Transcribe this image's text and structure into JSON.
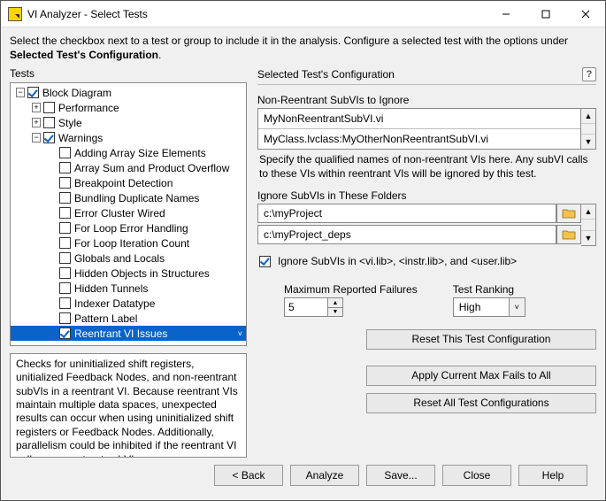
{
  "window": {
    "title": "VI Analyzer - Select Tests"
  },
  "intro": {
    "line1": "Select the checkbox next to a test or group to include it in the analysis.  Configure a selected test with the options under",
    "line2_bold": "Selected Test's Configuration",
    "period": "."
  },
  "left": {
    "label": "Tests",
    "tree": [
      {
        "depth": 0,
        "expander": "minus",
        "checked": true,
        "label": "Block Diagram"
      },
      {
        "depth": 1,
        "expander": "plus",
        "checked": false,
        "label": "Performance"
      },
      {
        "depth": 1,
        "expander": "plus",
        "checked": false,
        "label": "Style"
      },
      {
        "depth": 1,
        "expander": "minus",
        "checked": true,
        "label": "Warnings"
      },
      {
        "depth": 2,
        "expander": "",
        "checked": false,
        "label": "Adding Array Size Elements"
      },
      {
        "depth": 2,
        "expander": "",
        "checked": false,
        "label": "Array Sum and Product Overflow"
      },
      {
        "depth": 2,
        "expander": "",
        "checked": false,
        "label": "Breakpoint Detection"
      },
      {
        "depth": 2,
        "expander": "",
        "checked": false,
        "label": "Bundling Duplicate Names"
      },
      {
        "depth": 2,
        "expander": "",
        "checked": false,
        "label": "Error Cluster Wired"
      },
      {
        "depth": 2,
        "expander": "",
        "checked": false,
        "label": "For Loop Error Handling"
      },
      {
        "depth": 2,
        "expander": "",
        "checked": false,
        "label": "For Loop Iteration Count"
      },
      {
        "depth": 2,
        "expander": "",
        "checked": false,
        "label": "Globals and Locals"
      },
      {
        "depth": 2,
        "expander": "",
        "checked": false,
        "label": "Hidden Objects in Structures"
      },
      {
        "depth": 2,
        "expander": "",
        "checked": false,
        "label": "Hidden Tunnels"
      },
      {
        "depth": 2,
        "expander": "",
        "checked": false,
        "label": "Indexer Datatype"
      },
      {
        "depth": 2,
        "expander": "",
        "checked": false,
        "label": "Pattern Label"
      },
      {
        "depth": 2,
        "expander": "",
        "checked": true,
        "label": "Reentrant VI Issues",
        "selected": true
      }
    ],
    "description": "Checks for uninitialized shift registers, unitialized Feedback Nodes, and non-reentrant subVIs in a reentrant VI. Because reentrant VIs maintain multiple data spaces, unexpected results can occur when using uninitialized shift registers or Feedback Nodes. Additionally, parallelism could be inhibited if the reentrant VI calls non-reentrant subVIs."
  },
  "right": {
    "heading": "Selected Test's Configuration",
    "help_glyph": "?",
    "ignore_vis": {
      "label": "Non-Reentrant SubVIs to Ignore",
      "rows": [
        "MyNonReentrantSubVI.vi",
        "MyClass.lvclass:MyOtherNonReentrantSubVI.vi"
      ],
      "hint": "Specify the qualified names of non-reentrant VIs here. Any subVI calls to these VIs within reentrant VIs will be ignored by this test."
    },
    "ignore_folders": {
      "label": "Ignore SubVIs in These Folders",
      "rows": [
        "c:\\myProject",
        "c:\\myProject_deps"
      ]
    },
    "libs_check": {
      "checked": true,
      "label": "Ignore SubVIs in <vi.lib>, <instr.lib>, and <user.lib>"
    },
    "max_fail": {
      "label": "Maximum Reported Failures",
      "value": "5"
    },
    "ranking": {
      "label": "Test Ranking",
      "value": "High"
    },
    "buttons": {
      "reset_this": "Reset This Test Configuration",
      "apply_max": "Apply Current Max Fails to All",
      "reset_all": "Reset All Test Configurations"
    }
  },
  "footer": {
    "back": "< Back",
    "analyze": "Analyze",
    "save": "Save...",
    "close": "Close",
    "help": "Help"
  }
}
